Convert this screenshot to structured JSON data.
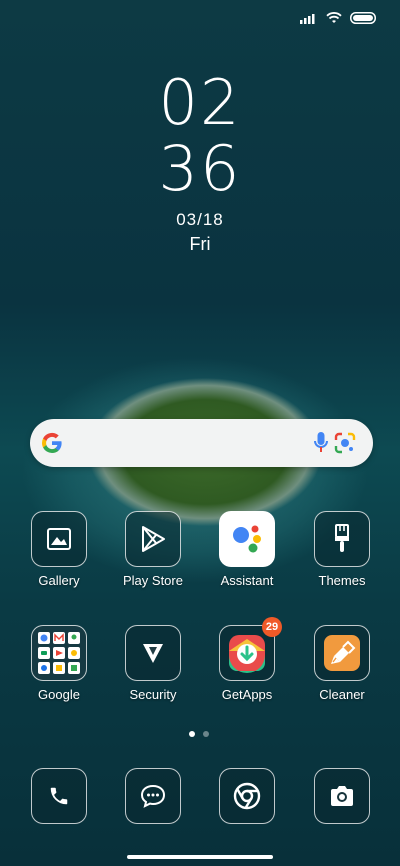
{
  "status_bar": {
    "icons": [
      "signal-icon",
      "wifi-icon",
      "battery-icon"
    ]
  },
  "clock": {
    "hours": "02",
    "minutes": "36",
    "date": "03/18",
    "day": "Fri"
  },
  "search": {
    "icons": [
      "google-g-icon",
      "microphone-icon",
      "google-lens-icon"
    ]
  },
  "apps_row1": [
    {
      "label": "Gallery",
      "icon": "gallery-icon"
    },
    {
      "label": "Play Store",
      "icon": "play-store-icon"
    },
    {
      "label": "Assistant",
      "icon": "assistant-icon"
    },
    {
      "label": "Themes",
      "icon": "brush-icon"
    }
  ],
  "apps_row2": [
    {
      "label": "Google",
      "icon": "google-folder-icon"
    },
    {
      "label": "Security",
      "icon": "security-icon"
    },
    {
      "label": "GetApps",
      "icon": "getapps-icon",
      "badge": "29"
    },
    {
      "label": "Cleaner",
      "icon": "cleaner-icon"
    }
  ],
  "page_indicator": {
    "pages": 2,
    "active": 1
  },
  "dock": [
    {
      "icon": "phone-icon"
    },
    {
      "icon": "messages-icon"
    },
    {
      "icon": "chrome-icon"
    },
    {
      "icon": "camera-icon"
    }
  ],
  "colors": {
    "badge": "#f05a28",
    "search_bg": "#f2f3f3"
  }
}
